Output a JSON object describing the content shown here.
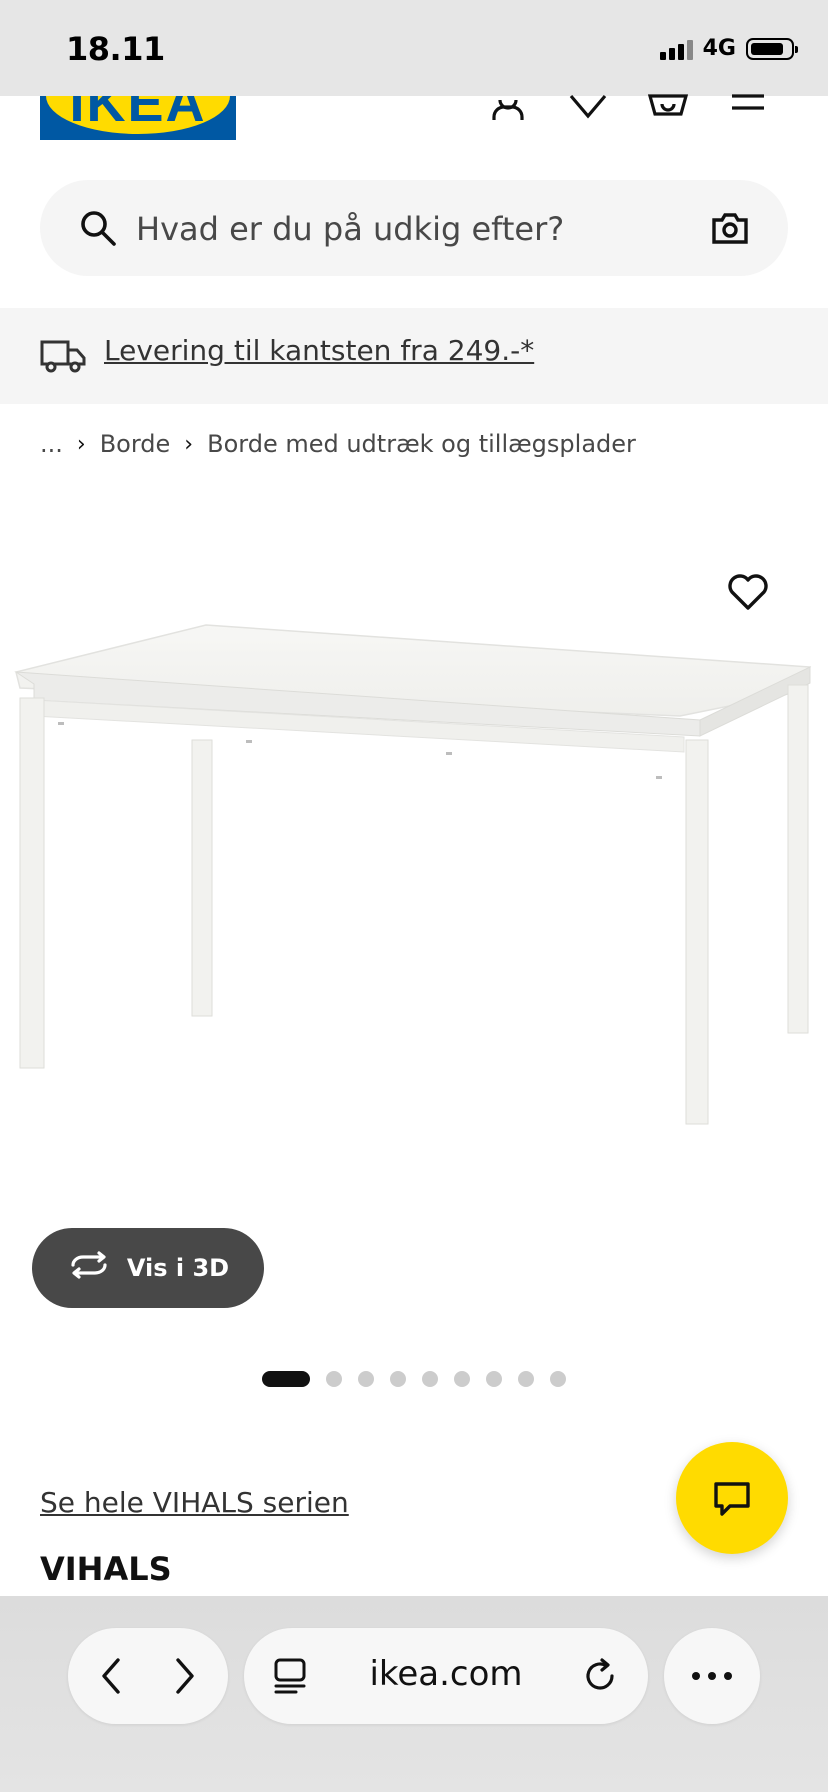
{
  "status_bar": {
    "time": "18.11",
    "network": "4G"
  },
  "header": {
    "logo_text": "IKEA",
    "icons": [
      "user-icon",
      "heart-icon",
      "basket-icon",
      "menu-icon"
    ]
  },
  "search": {
    "placeholder": "Hvad er du på udkig efter?"
  },
  "delivery": {
    "text": "Levering til kantsten fra 249.-*"
  },
  "breadcrumb": {
    "ellipsis": "...",
    "items": [
      "Borde",
      "Borde med udtræk og tillægsplader"
    ]
  },
  "product": {
    "view_3d_label": "Vis i 3D",
    "image_count": 9,
    "active_image": 1,
    "series_link": "Se hele VIHALS serien",
    "name": "VIHALS"
  },
  "browser": {
    "url": "ikea.com"
  },
  "colors": {
    "ikea_blue": "#0058a3",
    "ikea_yellow": "#ffdb00"
  }
}
